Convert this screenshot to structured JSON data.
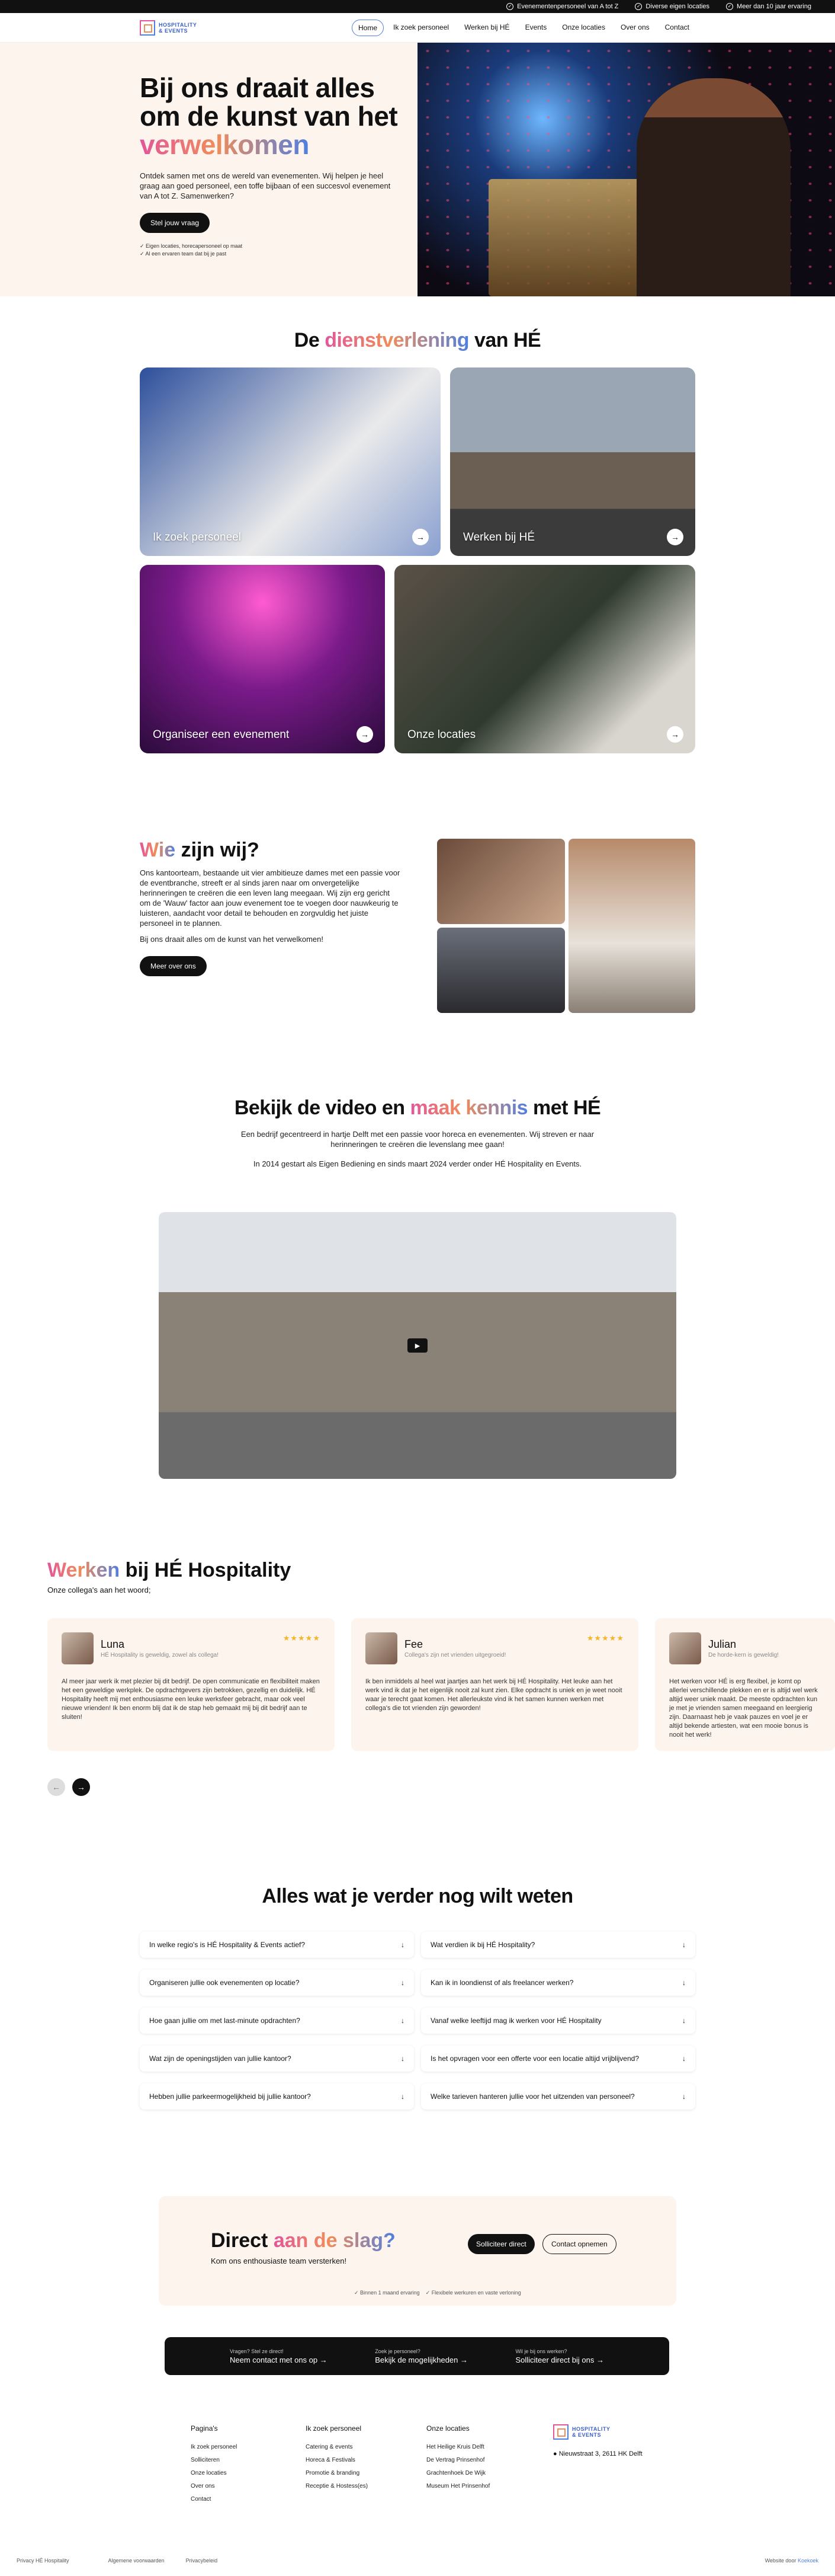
{
  "topbar": {
    "usps": [
      "Evenementenpersoneel van A tot Z",
      "Diverse eigen locaties",
      "Meer dan 10 jaar ervaring"
    ]
  },
  "nav": {
    "logo_line1": "HOSPITALITY",
    "logo_line2": "& EVENTS",
    "items": [
      "Home",
      "Ik zoek personeel",
      "Werken bij HÉ",
      "Events",
      "Onze locaties",
      "Over ons",
      "Contact"
    ]
  },
  "hero": {
    "title_pre": "Bij ons draait alles om de kunst van het",
    "title_accent": "verwelkomen",
    "text": "Ontdek samen met ons de wereld van evenementen. Wij helpen je heel graag aan goed personeel, een toffe bijbaan of een succesvol evenement van A tot Z. Samenwerken?",
    "button": "Stel jouw vraag",
    "checks": [
      "Eigen locaties, horecapersoneel op maat",
      "Al een ervaren team dat bij je past"
    ]
  },
  "services": {
    "title_pre": "De",
    "title_accent": "dienstverlening",
    "title_post": "van HÉ",
    "cards": [
      "Ik zoek personeel",
      "Werken bij HÉ",
      "Organiseer een evenement",
      "Onze locaties"
    ]
  },
  "about": {
    "title_accent": "Wie",
    "title_post": "zijn wij?",
    "p1": "Ons kantoorteam, bestaande uit vier ambitieuze dames met een passie voor de eventbranche, streeft er al sinds jaren naar om onvergetelijke herinneringen te creëren die een leven lang meegaan. Wij zijn erg gericht om de 'Wauw' factor aan jouw evenement toe te voegen door nauwkeurig te luisteren, aandacht voor detail te behouden en zorgvuldig het juiste personeel in te plannen.",
    "p2": "Bij ons draait alles om de kunst van het verwelkomen!",
    "button": "Meer over ons"
  },
  "video": {
    "title_pre": "Bekijk de video en",
    "title_accent": "maak kennis",
    "title_post": "met HÉ",
    "p1": "Een bedrijf gecentreerd in hartje Delft met een passie voor horeca en evenementen. Wij streven er naar herinneringen te creëren die levenslang mee gaan!",
    "p2": "In 2014 gestart als Eigen Bediening en sinds maart 2024 verder onder HÉ Hospitality en Events."
  },
  "werken": {
    "title_accent": "Werken",
    "title_post": "bij HÉ Hospitality",
    "sub": "Onze collega's aan het woord;",
    "testimonials": [
      {
        "name": "Luna",
        "role": "HÉ Hospitality is geweldig, zowel als collega!",
        "stars": "★★★★★",
        "text": "Al meer jaar werk ik met plezier bij dit bedrijf. De open communicatie en flexibiliteit maken het een geweldige werkplek. De opdrachtgevers zijn betrokken, gezellig en duidelijk. HÉ Hospitality heeft mij met enthousiasme een leuke werksfeer gebracht, maar ook veel nieuwe vrienden! Ik ben enorm blij dat ik de stap heb gemaakt mij bij dit bedrijf aan te sluiten!"
      },
      {
        "name": "Fee",
        "role": "Collega's zijn net vrienden uitgegroeid!",
        "stars": "★★★★★",
        "text": "Ik ben inmiddels al heel wat jaartjes aan het werk bij HÉ Hospitality. Het leuke aan het werk vind ik dat je het eigenlijk nooit zal kunt zien. Elke opdracht is uniek en je weet nooit waar je terecht gaat komen. Het allerleukste vind ik het samen kunnen werken met collega's die tot vrienden zijn geworden!"
      },
      {
        "name": "Julian",
        "role": "De horde-kern is geweldig!",
        "stars": "",
        "text": "Het werken voor HÉ is erg flexibel, je komt op allerlei verschillende plekken en er is altijd wel werk altijd weer uniek maakt. De meeste opdrachten kun je met je vrienden samen meegaand en leergierig zijn. Daarnaast heb je vaak pauzes en voel je er altijd bekende artiesten, wat een mooie bonus is nooit het werk!"
      }
    ]
  },
  "faq": {
    "title": "Alles wat je verder nog wilt weten",
    "left": [
      "In welke regio's is HÉ Hospitality & Events actief?",
      "Organiseren jullie ook evenementen op locatie?",
      "Hoe gaan jullie om met last-minute opdrachten?",
      "Wat zijn de openingstijden van jullie kantoor?",
      "Hebben jullie parkeermogelijkheid bij jullie kantoor?"
    ],
    "right": [
      "Wat verdien ik bij HÉ Hospitality?",
      "Kan ik in loondienst of als freelancer werken?",
      "Vanaf welke leeftijd mag ik werken voor HÉ Hospitality",
      "Is het opvragen voor een offerte voor een locatie altijd vrijblijvend?",
      "Welke tarieven hanteren jullie voor het uitzenden van personeel?"
    ]
  },
  "cta": {
    "title_pre": "Direct",
    "title_accent": "aan de slag?",
    "sub": "Kom ons enthousiaste team versterken!",
    "b1": "Solliciteer direct",
    "b2": "Contact opnemen",
    "checks": [
      "Binnen 1 maand ervaring",
      "Flexibele werkuren en vaste verloning"
    ]
  },
  "contactbar": [
    {
      "small": "Vragen? Stel ze direct!",
      "link": "Neem contact met ons op →"
    },
    {
      "small": "Zoek je personeel?",
      "link": "Bekijk de mogelijkheden →"
    },
    {
      "small": "Wil je bij ons werken?",
      "link": "Solliciteer direct bij ons →"
    }
  ],
  "footer": {
    "cols": [
      {
        "title": "Pagina's",
        "items": [
          "Ik zoek personeel",
          "Solliciteren",
          "Onze locaties",
          "Over ons",
          "Contact"
        ]
      },
      {
        "title": "Ik zoek personeel",
        "items": [
          "Catering & events",
          "Horeca & Festivals",
          "Promotie & branding",
          "Receptie & Hostess(es)"
        ]
      },
      {
        "title": "Onze locaties",
        "items": [
          "Het Heilige Kruis Delft",
          "De Vertrag Prinsenhof",
          "Grachtenhoek De Wijk",
          "Museum Het Prinsenhof"
        ]
      }
    ],
    "address": "Nieuwstraat 3, 2611 HK Delft"
  },
  "bottom": {
    "copy": "Privacy HÉ Hospitality",
    "terms": "Algemene voorwaarden",
    "privacy": "Privacybeleid",
    "credit_pre": "Website door",
    "credit": "Koekoek"
  }
}
